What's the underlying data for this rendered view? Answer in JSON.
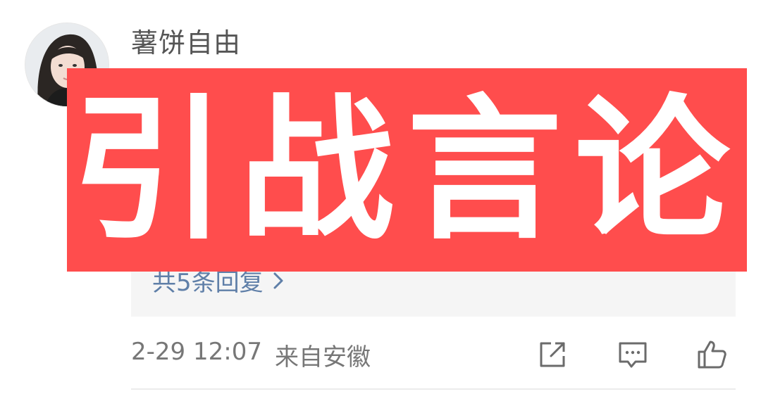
{
  "comment": {
    "username": "薯饼自由",
    "text": "",
    "replies_link": "共5条回复",
    "date": "2-29 12:07",
    "location": "来自安徽"
  },
  "overlay": {
    "label": "引战言论",
    "color": "#ff4d4d"
  },
  "icons": {
    "share": "share-icon",
    "comment": "comment-icon",
    "like": "thumbs-up-icon"
  }
}
